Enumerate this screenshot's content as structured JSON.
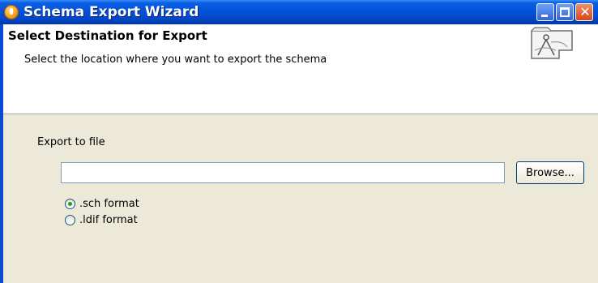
{
  "window": {
    "title": "Schema Export Wizard",
    "controls": {
      "minimize": "minimize",
      "maximize": "maximize",
      "close": "✕"
    }
  },
  "header": {
    "title": "Select Destination for Export",
    "description": "Select the location where you want to export the schema",
    "graphic_icon": "wizard-compass-icon"
  },
  "form": {
    "export_label": "Export to file",
    "file_value": "",
    "browse_label": "Browse...",
    "formats": [
      {
        "label": ".sch format",
        "selected": true
      },
      {
        "label": ".ldif format",
        "selected": false
      }
    ]
  },
  "colors": {
    "titlebar": "#0453d8",
    "dialog_bg": "#ece9d8",
    "header_bg": "#ffffff",
    "close_button": "#d8461c"
  }
}
